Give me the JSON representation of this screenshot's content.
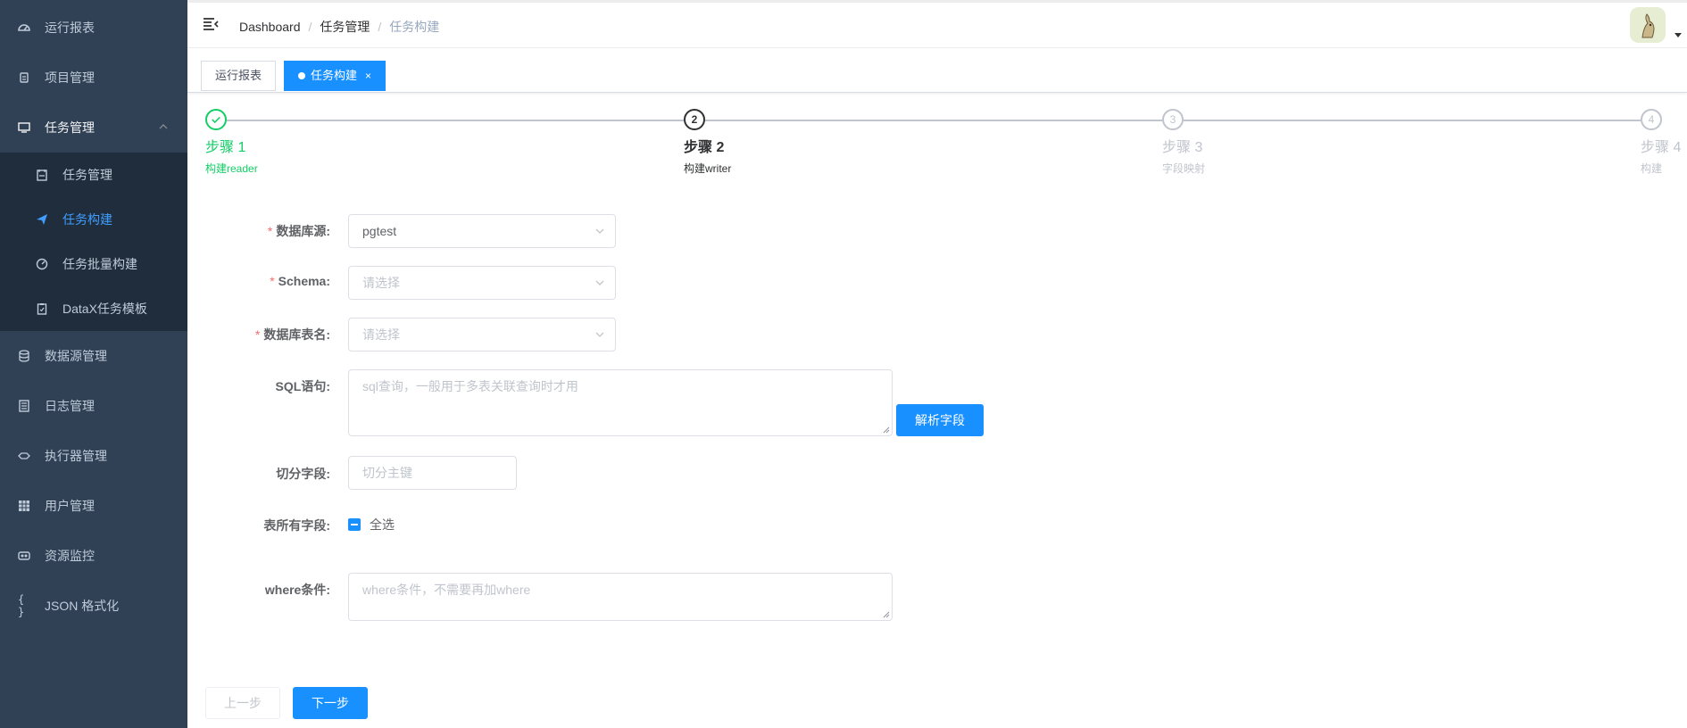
{
  "sidebar": {
    "items": [
      {
        "label": "运行报表",
        "icon": "dashboard-icon"
      },
      {
        "label": "项目管理",
        "icon": "project-icon"
      },
      {
        "label": "任务管理",
        "icon": "monitor-icon",
        "open": true
      },
      {
        "label": "数据源管理",
        "icon": "database-icon"
      },
      {
        "label": "日志管理",
        "icon": "document-icon"
      },
      {
        "label": "执行器管理",
        "icon": "executor-icon"
      },
      {
        "label": "用户管理",
        "icon": "table-icon"
      },
      {
        "label": "资源监控",
        "icon": "resource-icon"
      },
      {
        "label": "JSON 格式化",
        "icon": "braces-icon"
      }
    ],
    "submenu": [
      {
        "label": "任务管理",
        "icon": "calendar-icon"
      },
      {
        "label": "任务构建",
        "icon": "paper-plane-icon",
        "active": true
      },
      {
        "label": "任务批量构建",
        "icon": "gauge-icon"
      },
      {
        "label": "DataX任务模板",
        "icon": "clipboard-icon"
      }
    ]
  },
  "navbar": {
    "breadcrumb": [
      "Dashboard",
      "任务管理",
      "任务构建"
    ]
  },
  "tags": [
    {
      "label": "运行报表",
      "active": false
    },
    {
      "label": "任务构建",
      "active": true,
      "close": "×"
    }
  ],
  "steps": [
    {
      "num": "1",
      "title": "步骤 1",
      "desc": "构建reader",
      "status": "finish"
    },
    {
      "num": "2",
      "title": "步骤 2",
      "desc": "构建writer",
      "status": "process"
    },
    {
      "num": "3",
      "title": "步骤 3",
      "desc": "字段映射",
      "status": "wait"
    },
    {
      "num": "4",
      "title": "步骤 4",
      "desc": "构建",
      "status": "wait"
    }
  ],
  "form": {
    "datasource": {
      "label": "数据库源:",
      "value": "pgtest"
    },
    "schema": {
      "label": "Schema:",
      "placeholder": "请选择"
    },
    "table": {
      "label": "数据库表名:",
      "placeholder": "请选择"
    },
    "sql": {
      "label": "SQL语句:",
      "placeholder": "sql查询，一般用于多表关联查询时才用"
    },
    "parse_button": "解析字段",
    "split": {
      "label": "切分字段:",
      "placeholder": "切分主键"
    },
    "all_fields": {
      "label": "表所有字段:",
      "checkbox_label": "全选"
    },
    "where": {
      "label": "where条件:",
      "placeholder": "where条件，不需要再加where"
    }
  },
  "buttons": {
    "prev": "上一步",
    "next": "下一步"
  },
  "colors": {
    "sidebar_bg": "#304156",
    "submenu_bg": "#1f2d3d",
    "primary": "#1890ff",
    "active_menu_text": "#409eff",
    "finish": "#13ce66",
    "required": "#f56c6c"
  }
}
